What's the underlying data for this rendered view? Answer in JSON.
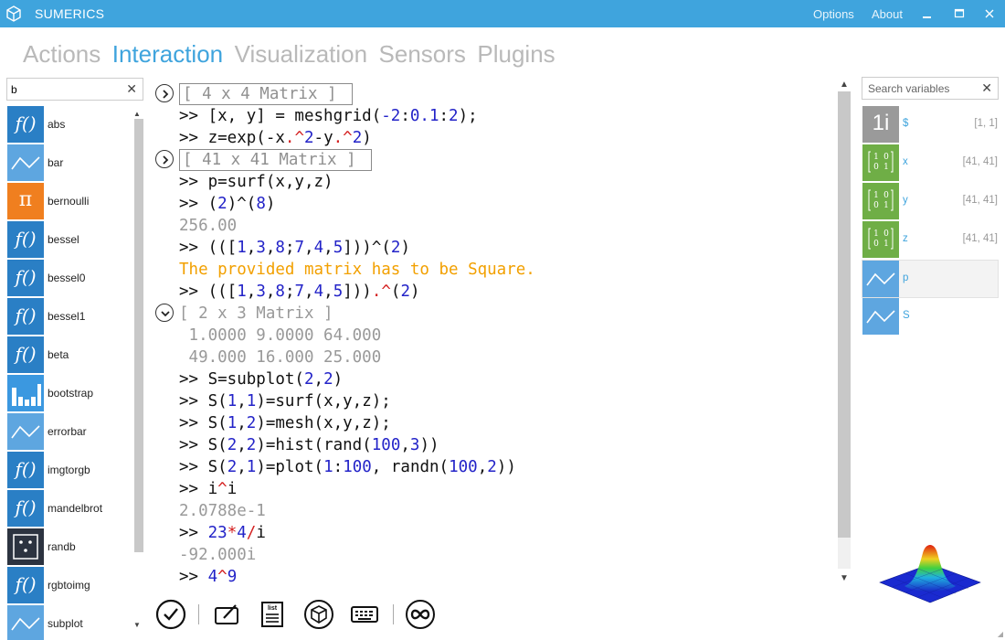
{
  "window": {
    "title": "SUMERICS",
    "menu": [
      "Options",
      "About"
    ],
    "brand_color": "#3fa4dd"
  },
  "tabs": [
    {
      "label": "Actions",
      "active": false
    },
    {
      "label": "Interaction",
      "active": true
    },
    {
      "label": "Visualization",
      "active": false
    },
    {
      "label": "Sensors",
      "active": false
    },
    {
      "label": "Plugins",
      "active": false
    }
  ],
  "function_panel": {
    "search_value": "b",
    "items": [
      {
        "label": "abs",
        "icon": "function-icon"
      },
      {
        "label": "bar",
        "icon": "line-chart-icon"
      },
      {
        "label": "bernoulli",
        "icon": "pi-icon"
      },
      {
        "label": "bessel",
        "icon": "function-icon"
      },
      {
        "label": "bessel0",
        "icon": "function-icon"
      },
      {
        "label": "bessel1",
        "icon": "function-icon"
      },
      {
        "label": "beta",
        "icon": "function-icon"
      },
      {
        "label": "bootstrap",
        "icon": "bar-chart-icon"
      },
      {
        "label": "errorbar",
        "icon": "line-chart-icon"
      },
      {
        "label": "imgtorgb",
        "icon": "function-icon"
      },
      {
        "label": "mandelbrot",
        "icon": "function-icon"
      },
      {
        "label": "randb",
        "icon": "dice-icon"
      },
      {
        "label": "rgbtoimg",
        "icon": "function-icon"
      },
      {
        "label": "subplot",
        "icon": "line-chart-icon"
      }
    ]
  },
  "console": {
    "l0": "[ 4 x 4 Matrix ]",
    "l1_pre": ">> [x, y] = meshgrid(",
    "l1_n1": "-2",
    "l1_s1": ":",
    "l1_n2": "0.1",
    "l1_s2": ":",
    "l1_n3": "2",
    "l1_post": ");",
    "l2_pre": ">> z=exp(-x",
    "l2_op1": ".^",
    "l2_n1": "2",
    "l2_mid": "-y",
    "l2_op2": ".^",
    "l2_n2": "2",
    "l2_post": ")",
    "l3": "[ 41 x 41 Matrix ]",
    "l4": ">> p=surf(x,y,z)",
    "l5_pre": ">> (",
    "l5_n1": "2",
    "l5_mid": ")^(",
    "l5_n2": "8",
    "l5_post": ")",
    "l6": "256.00",
    "l7_pre": ">> (([",
    "l7_n1": "1",
    "l7_c1": ",",
    "l7_n2": "3",
    "l7_c2": ",",
    "l7_n3": "8",
    "l7_c3": ";",
    "l7_n4": "7",
    "l7_c4": ",",
    "l7_n5": "4",
    "l7_c5": ",",
    "l7_n6": "5",
    "l7_mid": "]))^(",
    "l7_n7": "2",
    "l7_post": ")",
    "l8": "The provided matrix has to be Square.",
    "l9_pre": ">> (([",
    "l9_n1": "1",
    "l9_c1": ",",
    "l9_n2": "3",
    "l9_c2": ",",
    "l9_n3": "8",
    "l9_c3": ";",
    "l9_n4": "7",
    "l9_c4": ",",
    "l9_n5": "4",
    "l9_c5": ",",
    "l9_n6": "5",
    "l9_mid": "]))",
    "l9_op": ".^",
    "l9_open": "(",
    "l9_n7": "2",
    "l9_post": ")",
    "l10": "[ 2 x 3 Matrix ]",
    "l11": " 1.0000 9.0000 64.000",
    "l12": " 49.000 16.000 25.000",
    "l13_pre": ">> S=subplot(",
    "l13_n1": "2",
    "l13_c": ",",
    "l13_n2": "2",
    "l13_post": ")",
    "l14_pre": ">> S(",
    "l14_n1": "1",
    "l14_c": ",",
    "l14_n2": "1",
    "l14_post": ")=surf(x,y,z);",
    "l15_pre": ">> S(",
    "l15_n1": "1",
    "l15_c": ",",
    "l15_n2": "2",
    "l15_post": ")=mesh(x,y,z);",
    "l16_pre": ">> S(",
    "l16_n1": "2",
    "l16_c": ",",
    "l16_n2": "2",
    "l16_mid": ")=hist(rand(",
    "l16_n3": "100",
    "l16_c2": ",",
    "l16_n4": "3",
    "l16_post": "))",
    "l17_pre": ">> S(",
    "l17_n1": "2",
    "l17_c": ",",
    "l17_n2": "1",
    "l17_mid": ")=plot(",
    "l17_n3": "1",
    "l17_col": ":",
    "l17_n4": "100",
    "l17_mid2": ", randn(",
    "l17_n5": "100",
    "l17_c2": ",",
    "l17_n6": "2",
    "l17_post": "))",
    "l18_pre": ">> i",
    "l18_op": "^",
    "l18_post": "i",
    "l19": "2.0788e-1",
    "l20_pre": ">> ",
    "l20_n1": "23",
    "l20_op1": "*",
    "l20_n2": "4",
    "l20_op2": "/",
    "l20_post": "i",
    "l21": "-92.000i",
    "l22_pre": ">> ",
    "l22_n1": "4",
    "l22_op": "^",
    "l22_n2": "9"
  },
  "toolbar": {
    "buttons": [
      "check-icon",
      "edit-icon",
      "list-icon",
      "cube-icon",
      "keyboard-icon",
      "infinity-icon"
    ],
    "list_icon_text": "list"
  },
  "variable_panel": {
    "search_placeholder": "Search variables",
    "items": [
      {
        "name": "$",
        "size": "[1, 1]",
        "icon": "scalar-icon",
        "icon_text": "1i"
      },
      {
        "name": "x",
        "size": "[41, 41]",
        "icon": "matrix-icon"
      },
      {
        "name": "y",
        "size": "[41, 41]",
        "icon": "matrix-icon"
      },
      {
        "name": "z",
        "size": "[41, 41]",
        "icon": "matrix-icon"
      },
      {
        "name": "p",
        "size": "",
        "icon": "plot-icon",
        "selected": true
      },
      {
        "name": "S",
        "size": "",
        "icon": "plot-icon"
      }
    ],
    "matrix_glyph": [
      "1",
      "0",
      "0",
      "1"
    ]
  }
}
